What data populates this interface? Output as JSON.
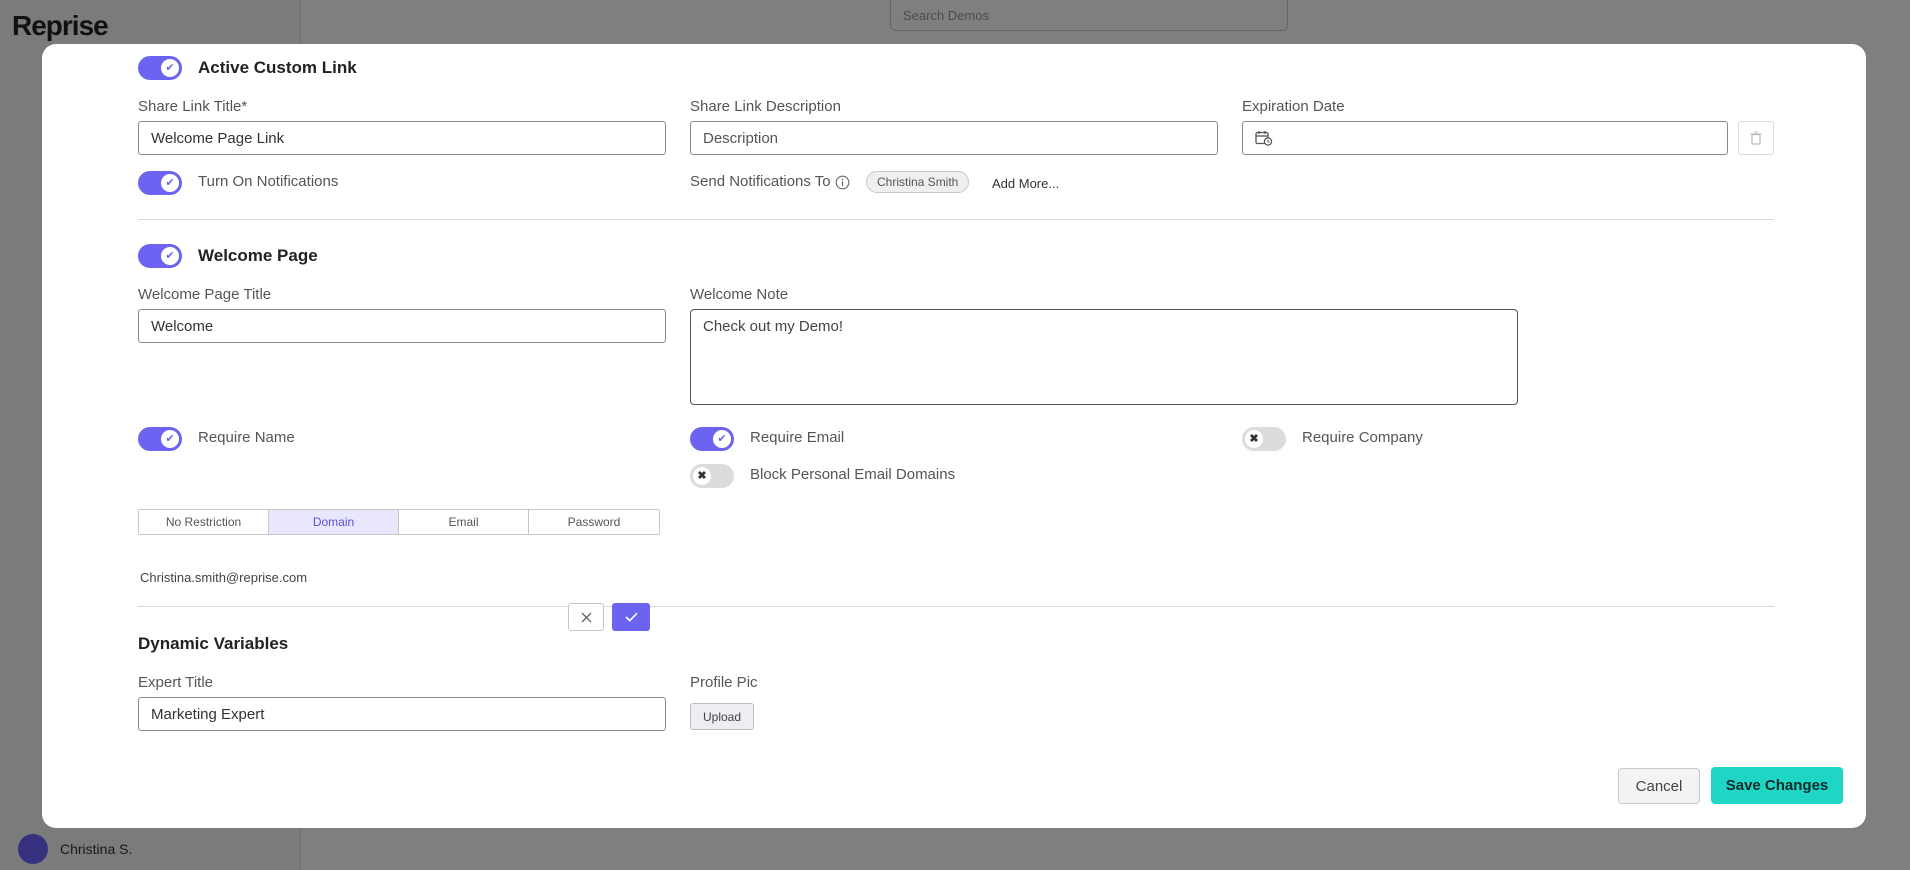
{
  "background": {
    "logo": "Reprise",
    "search_placeholder": "Search Demos",
    "user_name": "Christina S."
  },
  "custom_link": {
    "section_title": "Active Custom Link",
    "toggle_on": true,
    "title_label": "Share Link Title*",
    "title_value": "Welcome Page Link",
    "description_label": "Share Link Description",
    "description_placeholder": "Description",
    "expiration_label": "Expiration Date",
    "notifications_label": "Turn On Notifications",
    "notifications_on": true,
    "send_to_label": "Send Notifications To",
    "recipients": [
      "Christina Smith"
    ],
    "add_more_label": "Add More..."
  },
  "welcome_page": {
    "section_title": "Welcome Page",
    "toggle_on": true,
    "title_label": "Welcome Page Title",
    "title_value": "Welcome",
    "note_label": "Welcome Note",
    "note_value": "Check out my Demo!",
    "require_name_label": "Require Name",
    "require_name_on": true,
    "require_email_label": "Require Email",
    "require_email_on": true,
    "require_company_label": "Require Company",
    "require_company_on": false,
    "block_personal_label": "Block Personal Email Domains",
    "block_personal_on": false,
    "restriction_options": [
      "No Restriction",
      "Domain",
      "Email",
      "Password"
    ],
    "restriction_selected": "Domain",
    "domain_value": "Christina.smith@reprise.com"
  },
  "dynamic_variables": {
    "section_title": "Dynamic Variables",
    "expert_title_label": "Expert Title",
    "expert_title_value": "Marketing Expert",
    "profile_pic_label": "Profile Pic",
    "upload_label": "Upload"
  },
  "footer": {
    "cancel_label": "Cancel",
    "save_label": "Save Changes"
  },
  "colors": {
    "accent": "#6c63f0",
    "save": "#1ed6c3"
  }
}
